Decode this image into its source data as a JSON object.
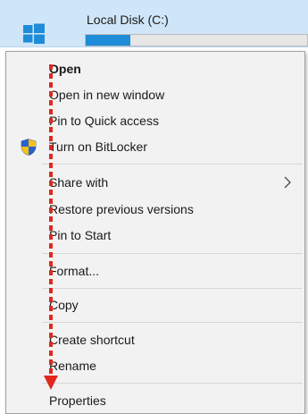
{
  "drive": {
    "title": "Local Disk (C:)",
    "capacity_used_fraction": 0.2
  },
  "menu": {
    "items": {
      "open": "Open",
      "open_new_window": "Open in new window",
      "pin_quick_access": "Pin to Quick access",
      "turn_on_bitlocker": "Turn on BitLocker",
      "share_with": "Share with",
      "restore_previous": "Restore previous versions",
      "pin_to_start": "Pin to Start",
      "format": "Format...",
      "copy": "Copy",
      "create_shortcut": "Create shortcut",
      "rename": "Rename",
      "properties": "Properties"
    }
  },
  "colors": {
    "header_bg": "#cfe6f8",
    "capacity_fill": "#1e8cd8",
    "annotation_arrow": "#e0281e",
    "menu_bg": "#f2f2f2"
  },
  "icons": {
    "drive": "windows-logo-icon",
    "bitlocker": "shield-icon",
    "submenu": "chevron-right-icon"
  }
}
